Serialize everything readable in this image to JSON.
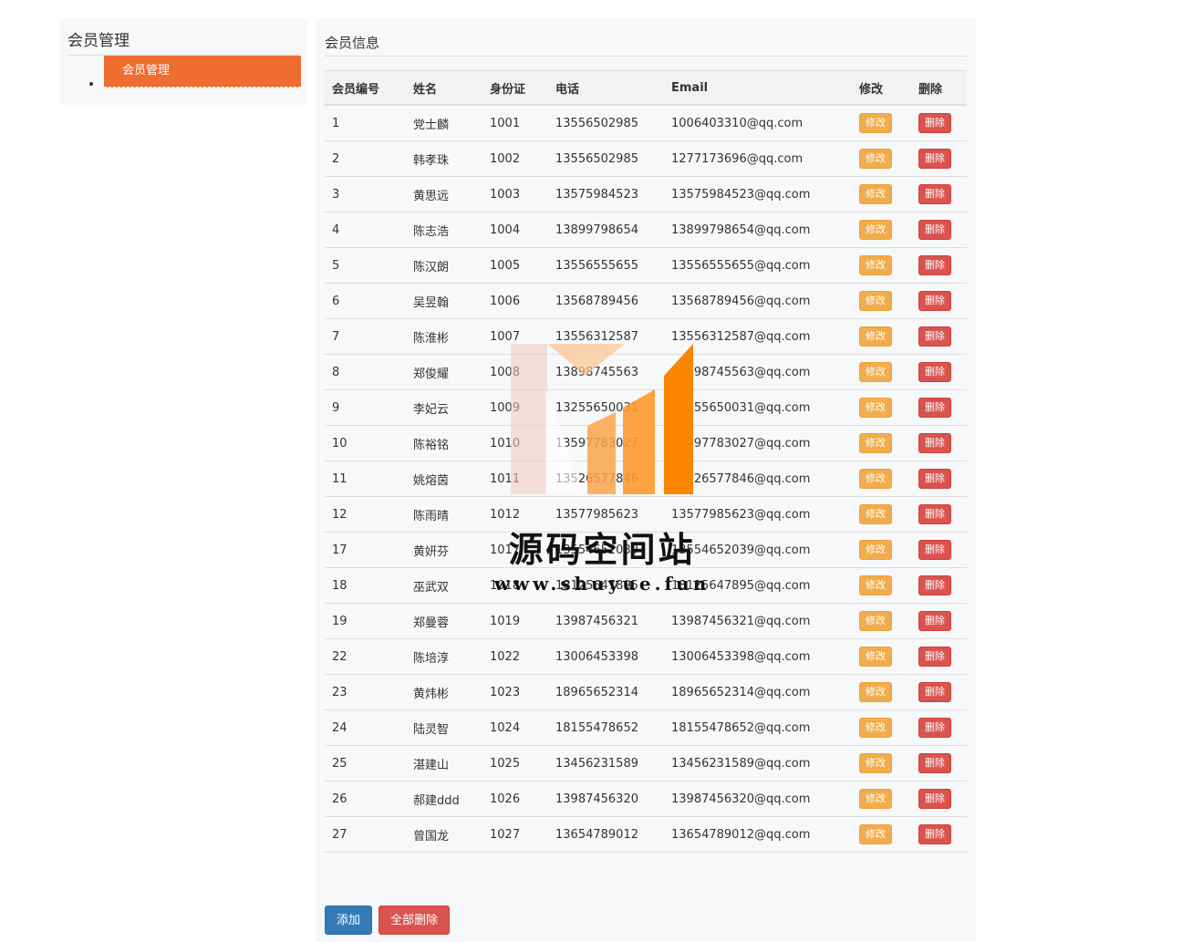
{
  "sidebar": {
    "title": "会员管理",
    "items": [
      {
        "label": "会员管理"
      }
    ]
  },
  "main": {
    "title": "会员信息",
    "table": {
      "columns": [
        "会员编号",
        "姓名",
        "身份证",
        "电话",
        "Email",
        "修改",
        "删除"
      ],
      "rows": [
        [
          "1",
          "党士麟",
          "1001",
          "13556502985",
          "1006403310@qq.com"
        ],
        [
          "2",
          "韩孝珠",
          "1002",
          "13556502985",
          "1277173696@qq.com"
        ],
        [
          "3",
          "黄思远",
          "1003",
          "13575984523",
          "13575984523@qq.com"
        ],
        [
          "4",
          "陈志浩",
          "1004",
          "13899798654",
          "13899798654@qq.com"
        ],
        [
          "5",
          "陈汉朗",
          "1005",
          "13556555655",
          "13556555655@qq.com"
        ],
        [
          "6",
          "吴昱翰",
          "1006",
          "13568789456",
          "13568789456@qq.com"
        ],
        [
          "7",
          "陈淮彬",
          "1007",
          "13556312587",
          "13556312587@qq.com"
        ],
        [
          "8",
          "郑俊耀",
          "1008",
          "13898745563",
          "13898745563@qq.com"
        ],
        [
          "9",
          "李妃云",
          "1009",
          "13255650031",
          "13255650031@qq.com"
        ],
        [
          "10",
          "陈裕铭",
          "1010",
          "13597783027",
          "13597783027@qq.com"
        ],
        [
          "11",
          "姚熔茵",
          "1011",
          "13526577846",
          "13526577846@qq.com"
        ],
        [
          "12",
          "陈雨晴",
          "1012",
          "13577985623",
          "13577985623@qq.com"
        ],
        [
          "17",
          "黄妍芬",
          "1017",
          "13554652039",
          "13554652039@qq.com"
        ],
        [
          "18",
          "巫武双",
          "1018",
          "18125647895",
          "18125647895@qq.com"
        ],
        [
          "19",
          "郑曼蓉",
          "1019",
          "13987456321",
          "13987456321@qq.com"
        ],
        [
          "22",
          "陈培淳",
          "1022",
          "13006453398",
          "13006453398@qq.com"
        ],
        [
          "23",
          "黄炜彬",
          "1023",
          "18965652314",
          "18965652314@qq.com"
        ],
        [
          "24",
          "陆灵智",
          "1024",
          "18155478652",
          "18155478652@qq.com"
        ],
        [
          "25",
          "湛建山",
          "1025",
          "13456231589",
          "13456231589@qq.com"
        ],
        [
          "26",
          "郝建ddd",
          "1026",
          "13987456320",
          "13987456320@qq.com"
        ],
        [
          "27",
          "曾国龙",
          "1027",
          "13654789012",
          "13654789012@qq.com"
        ]
      ],
      "edit_label": "修改",
      "delete_label": "删除"
    },
    "actions": {
      "add_label": "添加",
      "delete_all_label": "全部删除"
    }
  },
  "watermark": {
    "name": "源码空间站",
    "url": "www.shuyue.fun"
  },
  "colors": {
    "sidebar_active": "#ef6d2e",
    "edit_button": "#f0ad4e",
    "delete_button": "#d9534f",
    "primary_button": "#337ab7"
  }
}
